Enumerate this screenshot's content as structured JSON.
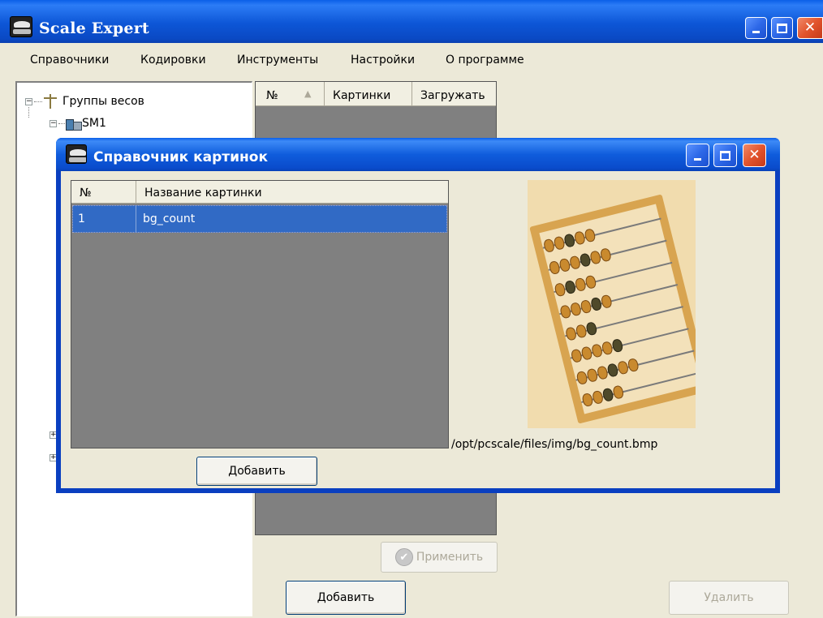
{
  "window": {
    "title": "Scale Expert",
    "menu": [
      "Справочники",
      "Кодировки",
      "Инструменты",
      "Настройки",
      "О программе"
    ]
  },
  "tree": {
    "root": "Группы весов",
    "child": "SM1"
  },
  "background_list": {
    "columns": [
      "№",
      "Картинки",
      "Загружать"
    ],
    "apply_label": "Применить",
    "add_label": "Добавить",
    "delete_label": "Удалить"
  },
  "dialog": {
    "title": "Справочник картинок",
    "columns": [
      "№",
      "Название картинки"
    ],
    "rows": [
      {
        "num": "1",
        "name": "bg_count"
      }
    ],
    "add_label": "Добавить",
    "image_path": "/opt/pcscale/files/img/bg_count.bmp"
  },
  "colors": {
    "titlebar": "#0a4ccc",
    "selection": "#316ac5",
    "list_bg": "#808080",
    "window_bg": "#ece9d8"
  }
}
